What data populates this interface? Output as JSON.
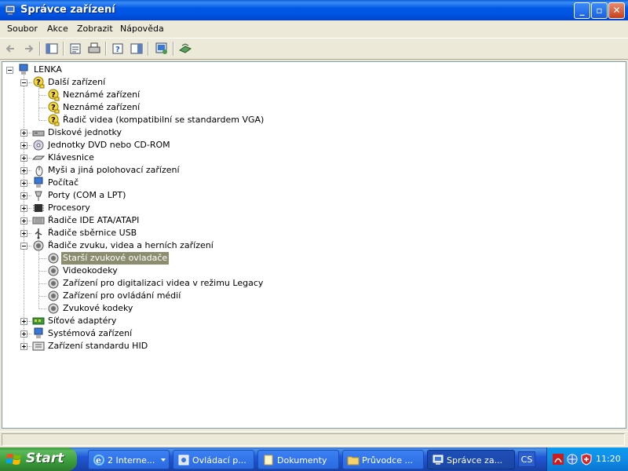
{
  "window": {
    "title": "Správce zařízení"
  },
  "menu": [
    "Soubor",
    "Akce",
    "Zobrazit",
    "Nápověda"
  ],
  "tree": {
    "root": "LENKA",
    "items": [
      {
        "label": "Další zařízení",
        "icon": "unknown-device-icon",
        "expanded": true
      },
      {
        "label": "Neznámé zařízení",
        "icon": "unknown-device-icon"
      },
      {
        "label": "Neznámé zařízení",
        "icon": "unknown-device-icon"
      },
      {
        "label": "Řadič videa (kompatibilní se standardem VGA)",
        "icon": "unknown-device-icon"
      },
      {
        "label": "Diskové jednotky",
        "icon": "disk-drive-icon"
      },
      {
        "label": "Jednotky DVD nebo CD-ROM",
        "icon": "dvd-drive-icon"
      },
      {
        "label": "Klávesnice",
        "icon": "keyboard-icon"
      },
      {
        "label": "Myši a jiná polohovací zařízení",
        "icon": "mouse-icon"
      },
      {
        "label": "Počítač",
        "icon": "computer-icon"
      },
      {
        "label": "Porty (COM a LPT)",
        "icon": "port-icon"
      },
      {
        "label": "Procesory",
        "icon": "processor-icon"
      },
      {
        "label": "Řadiče IDE ATA/ATAPI",
        "icon": "ide-controller-icon"
      },
      {
        "label": "Řadiče sběrnice USB",
        "icon": "usb-icon"
      },
      {
        "label": "Řadiče zvuku, videa a herních zařízení",
        "icon": "sound-icon",
        "expanded": true
      },
      {
        "label": "Starší zvukové ovladače",
        "icon": "sound-icon",
        "selected": true
      },
      {
        "label": "Videokodeky",
        "icon": "sound-icon"
      },
      {
        "label": "Zařízení pro digitalizaci videa v režimu Legacy",
        "icon": "sound-icon"
      },
      {
        "label": "Zařízení pro ovládání médií",
        "icon": "sound-icon"
      },
      {
        "label": "Zvukové kodeky",
        "icon": "sound-icon"
      },
      {
        "label": "Síťové adaptéry",
        "icon": "network-adapter-icon"
      },
      {
        "label": "Systémová zařízení",
        "icon": "system-device-icon"
      },
      {
        "label": "Zařízení standardu HID",
        "icon": "hid-icon"
      }
    ]
  },
  "taskbar": {
    "start": "Start",
    "tasks": [
      "2 Interne...",
      "Ovládací p...",
      "Dokumenty",
      "Průvodce ...",
      "Správce za..."
    ],
    "language": "CS",
    "clock": "11:20"
  },
  "colors": {
    "titlebar": "#0054e3",
    "selection": "#8c8c6e",
    "taskbar": "#2157d7",
    "start": "#3a9c3a"
  }
}
